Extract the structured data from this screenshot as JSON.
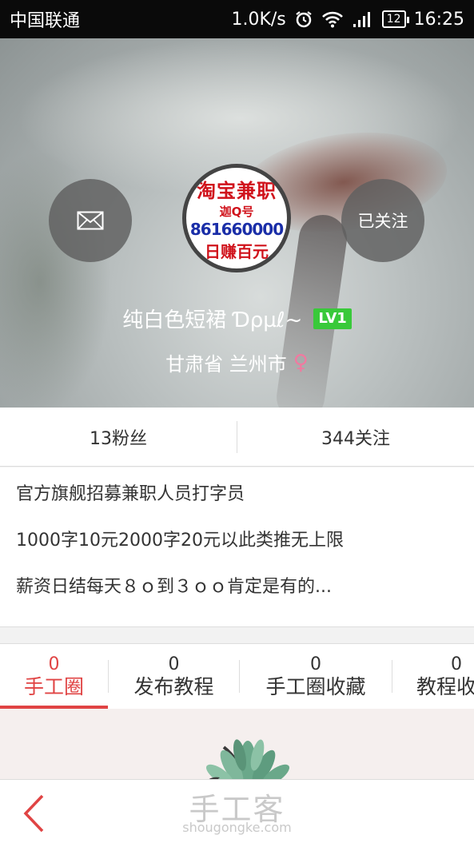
{
  "status_bar": {
    "carrier": "中国联通",
    "speed": "1.0K/s",
    "battery": "12",
    "time": "16:25"
  },
  "profile": {
    "avatar_lines": [
      "淘宝兼职",
      "迦Q号",
      "861660000",
      "日赚百元"
    ],
    "username": "纯白色短裙 Ɗρµℓ~",
    "level": "LV1",
    "location": "甘肃省 兰州市",
    "gender_symbol": "♀",
    "follow_label": "已关注"
  },
  "stats": {
    "fans": "13粉丝",
    "following": "344关注"
  },
  "bio": {
    "lines": [
      "官方旗舰招募兼职人员打字员",
      "1000字10元2000字20元以此类推无上限",
      "薪资日结每天８ｏ到３ｏｏ肯定是有的..."
    ]
  },
  "tabs": [
    {
      "count": "0",
      "label": "手工圈",
      "active": true
    },
    {
      "count": "0",
      "label": "发布教程",
      "active": false
    },
    {
      "count": "0",
      "label": "手工圈收藏",
      "active": false
    },
    {
      "count": "0",
      "label": "教程收藏",
      "active": false
    }
  ],
  "watermark": {
    "title": "手工客",
    "url": "shougongke.com"
  },
  "colors": {
    "accent": "#e04444",
    "level_badge": "#39c93a",
    "gender": "#f07aa0"
  }
}
